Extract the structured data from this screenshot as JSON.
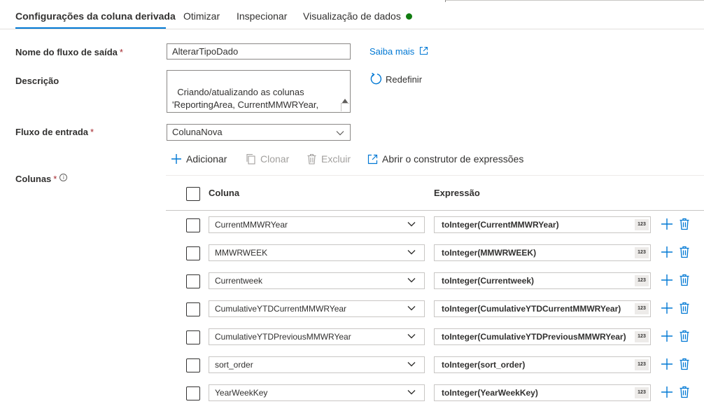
{
  "tabs": [
    {
      "label": "Configurações da coluna derivada"
    },
    {
      "label": "Otimizar"
    },
    {
      "label": "Inspecionar"
    },
    {
      "label": "Visualização de dados"
    }
  ],
  "colors": {
    "accent": "#0078d4",
    "status_dot": "#107c10",
    "required": "#a4262c"
  },
  "output_stream": {
    "label": "Nome do fluxo de saída",
    "required": "*",
    "value": "AlterarTipoDado",
    "learn_more": "Saiba mais"
  },
  "description": {
    "label": "Descrição",
    "value": "Criando/atualizando as colunas\n'ReportingArea, CurrentMMWRYear,\nMMWRWEEK, Label, Currentweek,",
    "reset": "Redefinir"
  },
  "input_stream": {
    "label": "Fluxo de entrada",
    "required": "*",
    "value": "ColunaNova"
  },
  "toolbar": {
    "add": "Adicionar",
    "clone": "Clonar",
    "delete": "Excluir",
    "open_builder": "Abrir o construtor de expressões"
  },
  "columns": {
    "label": "Colunas",
    "required": "*",
    "header_column": "Coluna",
    "header_expression": "Expressão",
    "rows": [
      {
        "column": "CurrentMMWRYear",
        "expression": "toInteger(CurrentMMWRYear)",
        "type_badge": "123"
      },
      {
        "column": "MMWRWEEK",
        "expression": "toInteger(MMWRWEEK)",
        "type_badge": "123"
      },
      {
        "column": "Currentweek",
        "expression": "toInteger(Currentweek)",
        "type_badge": "123"
      },
      {
        "column": "CumulativeYTDCurrentMMWRYear",
        "expression": "toInteger(CumulativeYTDCurrentMMWRYear)",
        "type_badge": "123"
      },
      {
        "column": "CumulativeYTDPreviousMMWRYear",
        "expression": "toInteger(CumulativeYTDPreviousMMWRYear)",
        "type_badge": "123"
      },
      {
        "column": "sort_order",
        "expression": "toInteger(sort_order)",
        "type_badge": "123"
      },
      {
        "column": "YearWeekKey",
        "expression": "toInteger(YearWeekKey)",
        "type_badge": "123"
      }
    ]
  }
}
